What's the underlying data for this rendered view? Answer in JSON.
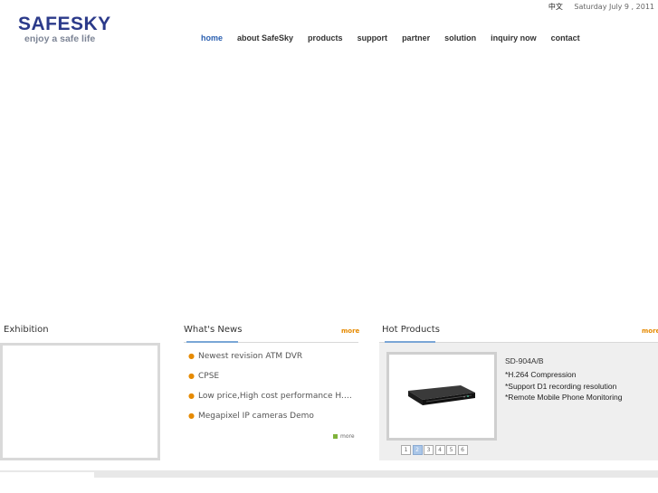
{
  "header": {
    "lang_link": "中文",
    "date": "Saturday July 9 , 2011"
  },
  "logo": {
    "brand": "SAFESKY",
    "tagline": "enjoy a safe life"
  },
  "nav": {
    "items": [
      "home",
      "about SafeSky",
      "products",
      "support",
      "partner",
      "solution",
      "inquiry now",
      "contact"
    ]
  },
  "exhibition": {
    "title": "Exhibition"
  },
  "news": {
    "title": "What's News",
    "more": "more",
    "items": [
      "Newest revision ATM DVR",
      "CPSE",
      "Low price,High cost performance H.2...",
      "Megapixel IP cameras Demo"
    ],
    "bottom_more": "more"
  },
  "hot_products": {
    "title": "Hot Products",
    "more": "more",
    "product_name": "SD-904A/B",
    "features": [
      "*H.264 Compression",
      "*Support D1  recording resolution",
      "*Remote Mobile Phone Monitoring"
    ],
    "pages": [
      "1",
      "2",
      "3",
      "4",
      "5",
      "6"
    ],
    "active_page": "2",
    "product_image": "dvr-recorder-image"
  },
  "colors": {
    "brand_blue": "#2b3a8a",
    "nav_active": "#2a5fb0",
    "more_orange": "#e68a00",
    "panel_bg": "#efefef"
  }
}
